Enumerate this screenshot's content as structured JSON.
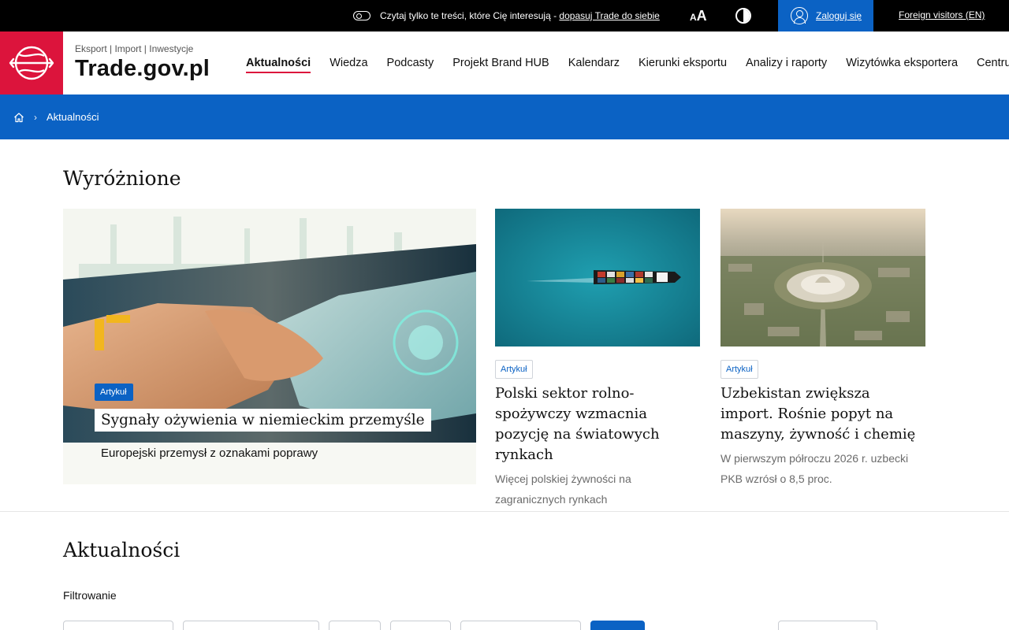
{
  "topbar": {
    "personalize_text": "Czytaj tylko te treści, które Cię interesują - ",
    "personalize_link": "dopasuj Trade do siebie",
    "login_label": "Zaloguj się",
    "foreign_label": "Foreign visitors (EN)"
  },
  "header": {
    "tagline": "Eksport | Import | Inwestycje",
    "site_title": "Trade.gov.pl",
    "nav": [
      "Aktualności",
      "Wiedza",
      "Podcasty",
      "Projekt Brand HUB",
      "Kalendarz",
      "Kierunki eksportu",
      "Analizy i raporty",
      "Wizytówka eksportera",
      "Centrum Ws"
    ]
  },
  "breadcrumb": {
    "current": "Aktualności"
  },
  "featured": {
    "heading": "Wyróżnione",
    "main": {
      "badge": "Artykuł",
      "title": "Sygnały ożywienia w niemieckim przemyśle",
      "lead": "Europejski przemysł z oznakami poprawy"
    },
    "cards": [
      {
        "badge": "Artykuł",
        "title": "Polski sektor rolno-spożywczy wzmacnia pozycję na światowych rynkach",
        "lead": "Więcej polskiej żywności na zagranicznych rynkach"
      },
      {
        "badge": "Artykuł",
        "title": "Uzbekistan zwiększa import. Rośnie popyt na maszyny, żywność i chemię",
        "lead": "W pierwszym półroczu 2026 r. uzbecki PKB wzrósł o 8,5 proc."
      }
    ]
  },
  "news": {
    "heading": "Aktualności",
    "filter_label": "Filtrowanie"
  },
  "colors": {
    "brand_red": "#dc143c",
    "brand_blue": "#0b62c4"
  }
}
